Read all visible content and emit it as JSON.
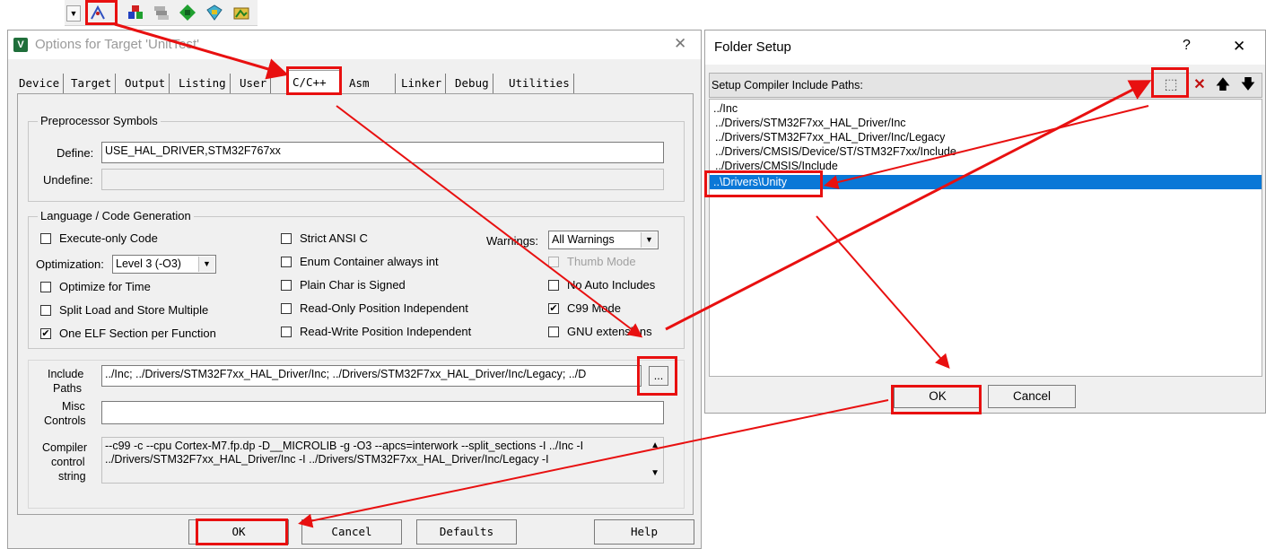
{
  "toolbar": {
    "icons": [
      "dropdown-arrow-icon",
      "options-for-target-icon",
      "manage-components-icon",
      "layers-icon",
      "green-diamond-icon",
      "select-pack-icon",
      "pack-installer-icon"
    ]
  },
  "options_dialog": {
    "title": "Options for Target 'UnitTest'",
    "close_glyph": "✕",
    "tabs": [
      "Device",
      "Target",
      "Output",
      "Listing",
      "User",
      "C/C++",
      "Asm",
      "Linker",
      "Debug",
      "Utilities"
    ],
    "active_tab": "C/C++",
    "preprocessor": {
      "group_label": "Preprocessor Symbols",
      "define_label": "Define:",
      "define_value": "USE_HAL_DRIVER,STM32F767xx",
      "undefine_label": "Undefine:",
      "undefine_value": ""
    },
    "language": {
      "group_label": "Language / Code Generation",
      "execute_only": "Execute-only Code",
      "optimization_label": "Optimization:",
      "optimization_value": "Level 3 (-O3)",
      "optimize_time": "Optimize for Time",
      "split_load": "Split Load and Store Multiple",
      "one_elf": "One ELF Section per Function",
      "strict_ansi": "Strict ANSI C",
      "enum_container": "Enum Container always int",
      "plain_char": "Plain Char is Signed",
      "ro_position": "Read-Only Position Independent",
      "rw_position": "Read-Write Position Independent",
      "warnings_label": "Warnings:",
      "warnings_value": "All Warnings",
      "thumb_mode": "Thumb Mode",
      "no_auto": "No Auto Includes",
      "c99_mode": "C99 Mode",
      "gnu_ext": "GNU extensions",
      "check_glyph": "✔"
    },
    "include_label_1": "Include",
    "include_label_2": "Paths",
    "include_value": "../Inc; ../Drivers/STM32F7xx_HAL_Driver/Inc; ../Drivers/STM32F7xx_HAL_Driver/Inc/Legacy; ../D",
    "browse_label": "...",
    "misc_label_1": "Misc",
    "misc_label_2": "Controls",
    "misc_value": "",
    "compiler_label_1": "Compiler",
    "compiler_label_2": "control",
    "compiler_label_3": "string",
    "compiler_line1": "--c99 -c --cpu Cortex-M7.fp.dp -D__MICROLIB -g -O3 --apcs=interwork --split_sections -I ../Inc -I",
    "compiler_line2": "../Drivers/STM32F7xx_HAL_Driver/Inc -I ../Drivers/STM32F7xx_HAL_Driver/Inc/Legacy -I",
    "buttons": {
      "ok": "OK",
      "cancel": "Cancel",
      "defaults": "Defaults",
      "help": "Help"
    }
  },
  "folder_dialog": {
    "title": "Folder Setup",
    "help_glyph": "?",
    "close_glyph": "✕",
    "header": "Setup Compiler Include Paths:",
    "paths": [
      "../Inc",
      "../Drivers/STM32F7xx_HAL_Driver/Inc",
      "../Drivers/STM32F7xx_HAL_Driver/Inc/Legacy",
      "../Drivers/CMSIS/Device/ST/STM32F7xx/Include",
      "../Drivers/CMSIS/Include",
      "..\\Drivers\\Unity"
    ],
    "selected_index": 5,
    "icon_glyphs": {
      "new": "⬚",
      "delete": "✕",
      "up": "🡅",
      "down": "🡇"
    },
    "buttons": {
      "ok": "OK",
      "cancel": "Cancel"
    }
  },
  "colors": {
    "annotation_red": "#e81010",
    "selection_blue": "#0a78d7"
  }
}
